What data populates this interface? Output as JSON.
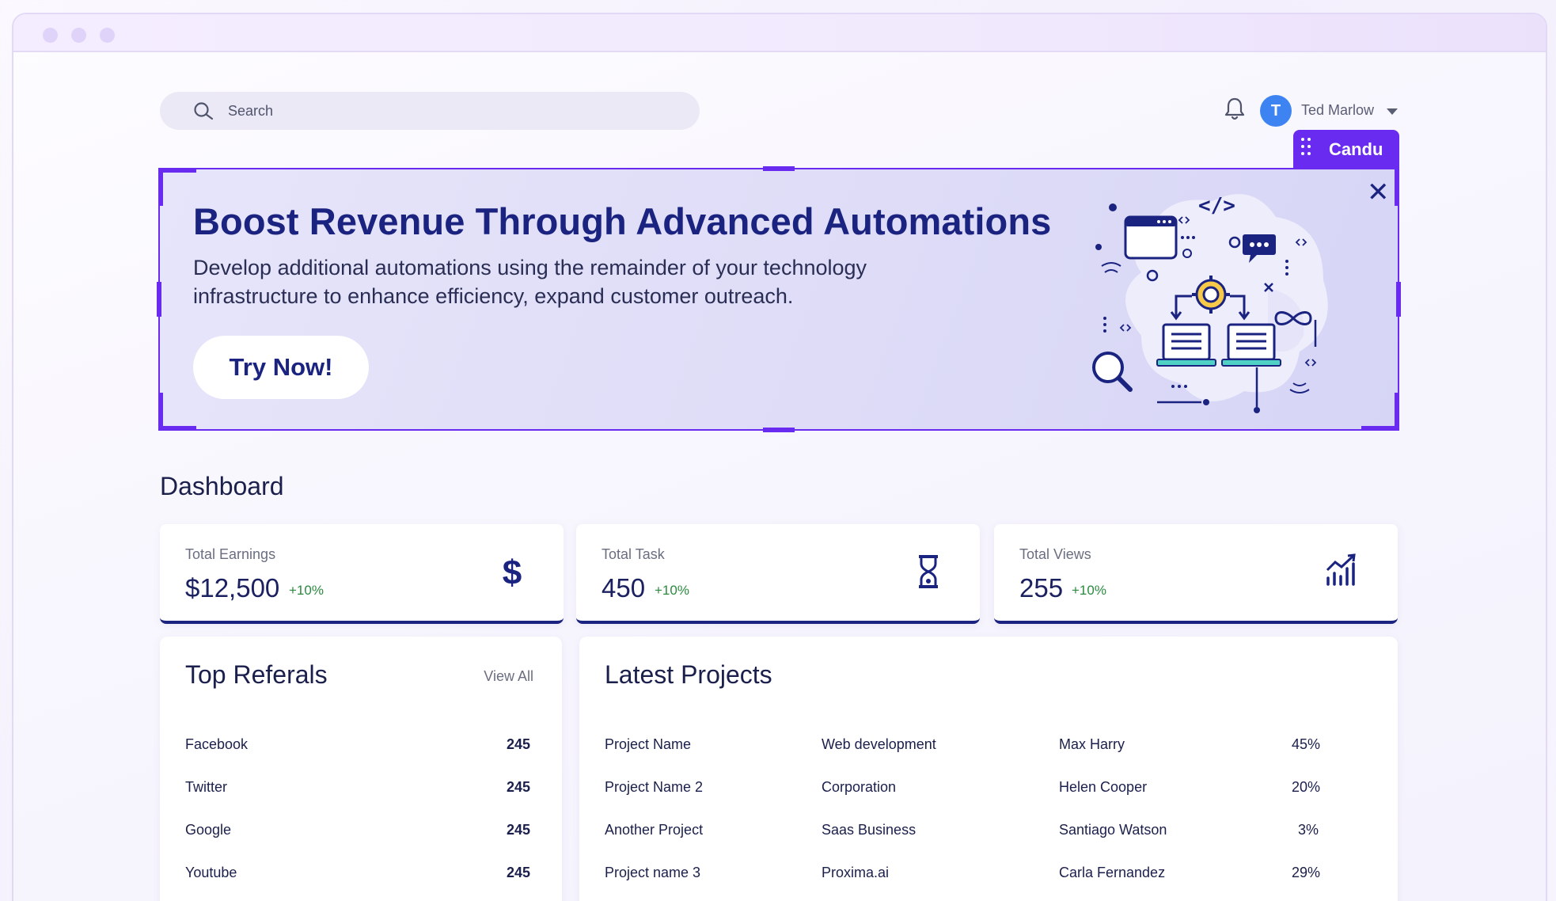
{
  "header": {
    "search_placeholder": "Search",
    "user_initial": "T",
    "user_name": "Ted Marlow"
  },
  "candu": {
    "label": "Candu"
  },
  "banner": {
    "title": "Boost Revenue Through Advanced Automations",
    "subtitle": "Develop additional automations using the remainder of your technology infrastructure to enhance efficiency, expand customer outreach.",
    "button_label": "Try Now!",
    "close_symbol": "✕"
  },
  "dashboard": {
    "title": "Dashboard",
    "stats": [
      {
        "label": "Total Earnings",
        "value": "$12,500",
        "delta": "+10%",
        "icon": "dollar-icon"
      },
      {
        "label": "Total Task",
        "value": "450",
        "delta": "+10%",
        "icon": "hourglass-icon"
      },
      {
        "label": "Total Views",
        "value": "255",
        "delta": "+10%",
        "icon": "chart-growth-icon"
      }
    ]
  },
  "referrals": {
    "title": "Top Referals",
    "view_all": "View All",
    "rows": [
      {
        "name": "Facebook",
        "value": "245"
      },
      {
        "name": "Twitter",
        "value": "245"
      },
      {
        "name": "Google",
        "value": "245"
      },
      {
        "name": "Youtube",
        "value": "245"
      }
    ]
  },
  "projects": {
    "title": "Latest Projects",
    "rows": [
      {
        "name": "Project Name",
        "category": "Web development",
        "owner": "Max Harry",
        "progress": "45%"
      },
      {
        "name": "Project Name 2",
        "category": "Corporation",
        "owner": "Helen Cooper",
        "progress": "20%"
      },
      {
        "name": "Another Project",
        "category": "Saas Business",
        "owner": "Santiago Watson",
        "progress": "3%"
      },
      {
        "name": "Project name 3",
        "category": "Proxima.ai",
        "owner": "Carla Fernandez",
        "progress": "29%"
      }
    ]
  },
  "colors": {
    "accent": "#6a2bf0",
    "navy": "#1b2380",
    "positive": "#2a8a3e",
    "avatar": "#3d84f2"
  }
}
